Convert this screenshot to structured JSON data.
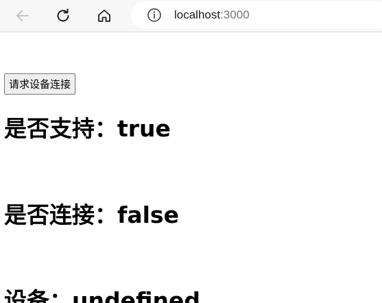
{
  "browser": {
    "url_host": "localhost",
    "url_port": ":3000",
    "icons": {
      "back": "back-arrow-icon",
      "refresh": "refresh-icon",
      "home": "home-icon",
      "info": "info-icon"
    }
  },
  "page": {
    "request_button_label": "请求设备连接",
    "supported_label": "是否支持：",
    "supported_value": "true",
    "connected_label": "是否连接：",
    "connected_value": "false",
    "device_label": "设备：",
    "device_value": "undefined"
  }
}
